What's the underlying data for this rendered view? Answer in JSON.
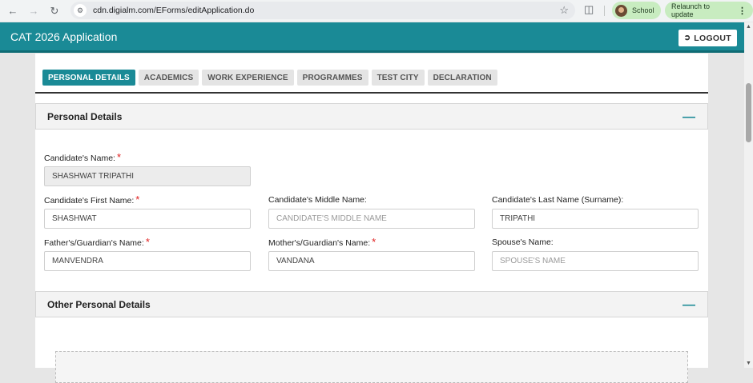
{
  "browser": {
    "url": "cdn.digialm.com/EForms/editApplication.do",
    "profile_label": "School",
    "relaunch_label": "Relaunch to update"
  },
  "app": {
    "title": "CAT 2026 Application",
    "logout_label": "LOGOUT"
  },
  "tabs": [
    {
      "label": "PERSONAL DETAILS",
      "active": true
    },
    {
      "label": "ACADEMICS",
      "active": false
    },
    {
      "label": "WORK EXPERIENCE",
      "active": false
    },
    {
      "label": "PROGRAMMES",
      "active": false
    },
    {
      "label": "TEST CITY",
      "active": false
    },
    {
      "label": "DECLARATION",
      "active": false
    }
  ],
  "personal": {
    "section_title": "Personal Details",
    "candidate_name": {
      "label": "Candidate's Name:",
      "value": "SHASHWAT TRIPATHI"
    },
    "first_name": {
      "label": "Candidate's First Name:",
      "value": "SHASHWAT"
    },
    "middle_name": {
      "label": "Candidate's Middle Name:",
      "value": "",
      "placeholder": "CANDIDATE'S MIDDLE NAME"
    },
    "last_name": {
      "label": "Candidate's Last Name (Surname):",
      "value": "TRIPATHI"
    },
    "father_name": {
      "label": "Father's/Guardian's Name:",
      "value": "MANVENDRA"
    },
    "mother_name": {
      "label": "Mother's/Guardian's Name:",
      "value": "VANDANA"
    },
    "spouse_name": {
      "label": "Spouse's Name:",
      "value": "",
      "placeholder": "SPOUSE'S NAME"
    },
    "required_mark": "*"
  },
  "other": {
    "section_title": "Other Personal Details"
  },
  "colors": {
    "primary": "#1a8a96",
    "required": "#e02020"
  }
}
